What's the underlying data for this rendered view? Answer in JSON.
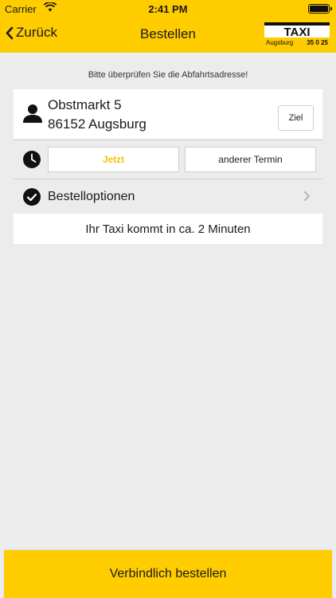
{
  "status_bar": {
    "carrier": "Carrier",
    "time": "2:41 PM"
  },
  "nav": {
    "back_label": "Zurück",
    "title": "Bestellen"
  },
  "logo": {
    "line1": "TAXI",
    "city": "Augsburg",
    "number": "35 0 25"
  },
  "hint": "Bitte überprüfen Sie die Abfahrtsadresse!",
  "address": {
    "street": "Obstmarkt 5",
    "city": "86152 Augsburg",
    "destination_button": "Ziel"
  },
  "time_selection": {
    "now_label": "Jetzt",
    "other_label": "anderer Termin"
  },
  "options": {
    "label": "Bestelloptionen"
  },
  "eta": "Ihr Taxi kommt in ca. 2 Minuten",
  "order_button": "Verbindlich bestellen",
  "colors": {
    "brand_yellow": "#ffcc00",
    "accent_text": "#f5c400",
    "background": "#ececec"
  }
}
